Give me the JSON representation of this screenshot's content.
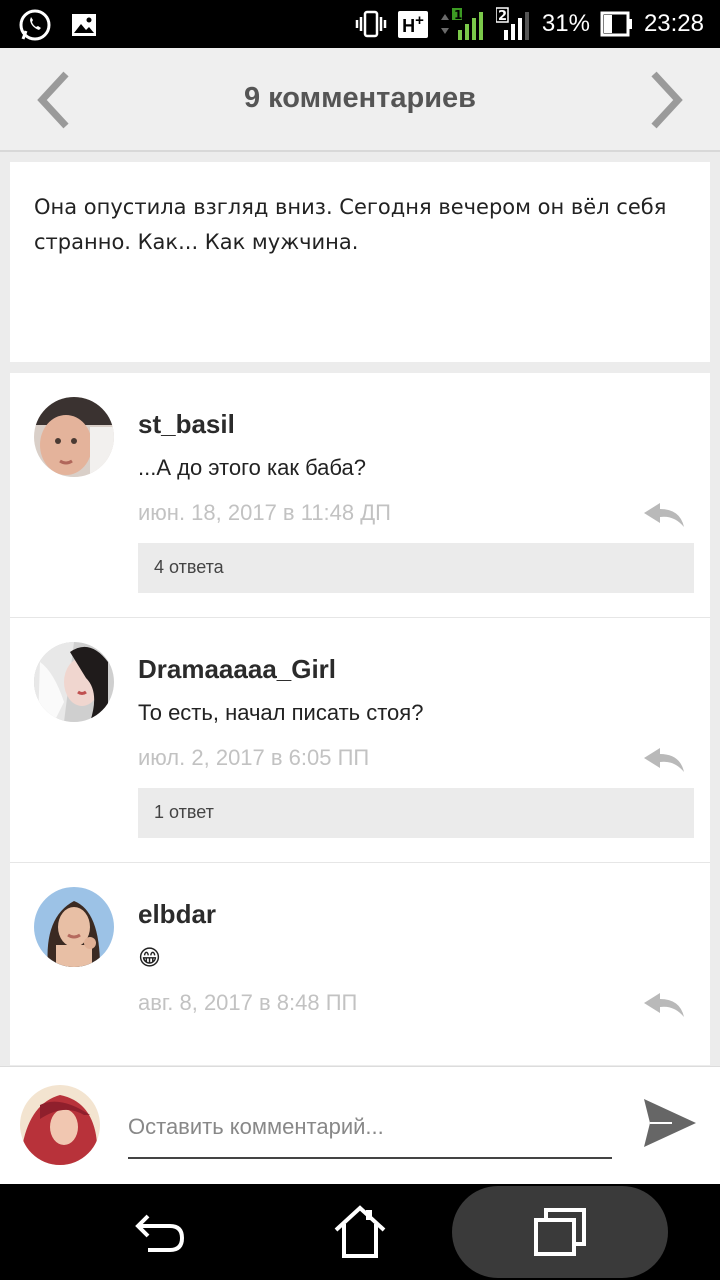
{
  "status_bar": {
    "network": "H",
    "network_plus": "+",
    "sim1": "1",
    "sim2": "2",
    "battery": "31%",
    "time": "23:28",
    "icons": [
      "whatsapp-icon",
      "gallery-icon",
      "vibrate-icon",
      "signal-icon",
      "battery-icon"
    ]
  },
  "header": {
    "title": "9 комментариев"
  },
  "quote": {
    "text": "Она опустила взгляд вниз. Сегодня вечером он вёл себя странно. Как... Как мужчина."
  },
  "comments": [
    {
      "author": "st_basil",
      "text": "...А до этого как баба?",
      "time": "июн. 18, 2017 в 11:48 ДП",
      "replies": "4 ответа"
    },
    {
      "author": "Dramaaaaa_Girl",
      "text": "То есть, начал писать стоя?",
      "time": "июл. 2, 2017 в 6:05 ПП",
      "replies": "1 ответ"
    },
    {
      "author": "elbdar",
      "text": "😁",
      "time": "авг. 8, 2017 в 8:48 ПП",
      "replies": ""
    }
  ],
  "composer": {
    "placeholder": "Оставить комментарий..."
  },
  "colors": {
    "header_bg": "#efefef",
    "title": "#555555",
    "timestamp": "#c2c2c2",
    "replies_bg": "#ebebeb"
  }
}
